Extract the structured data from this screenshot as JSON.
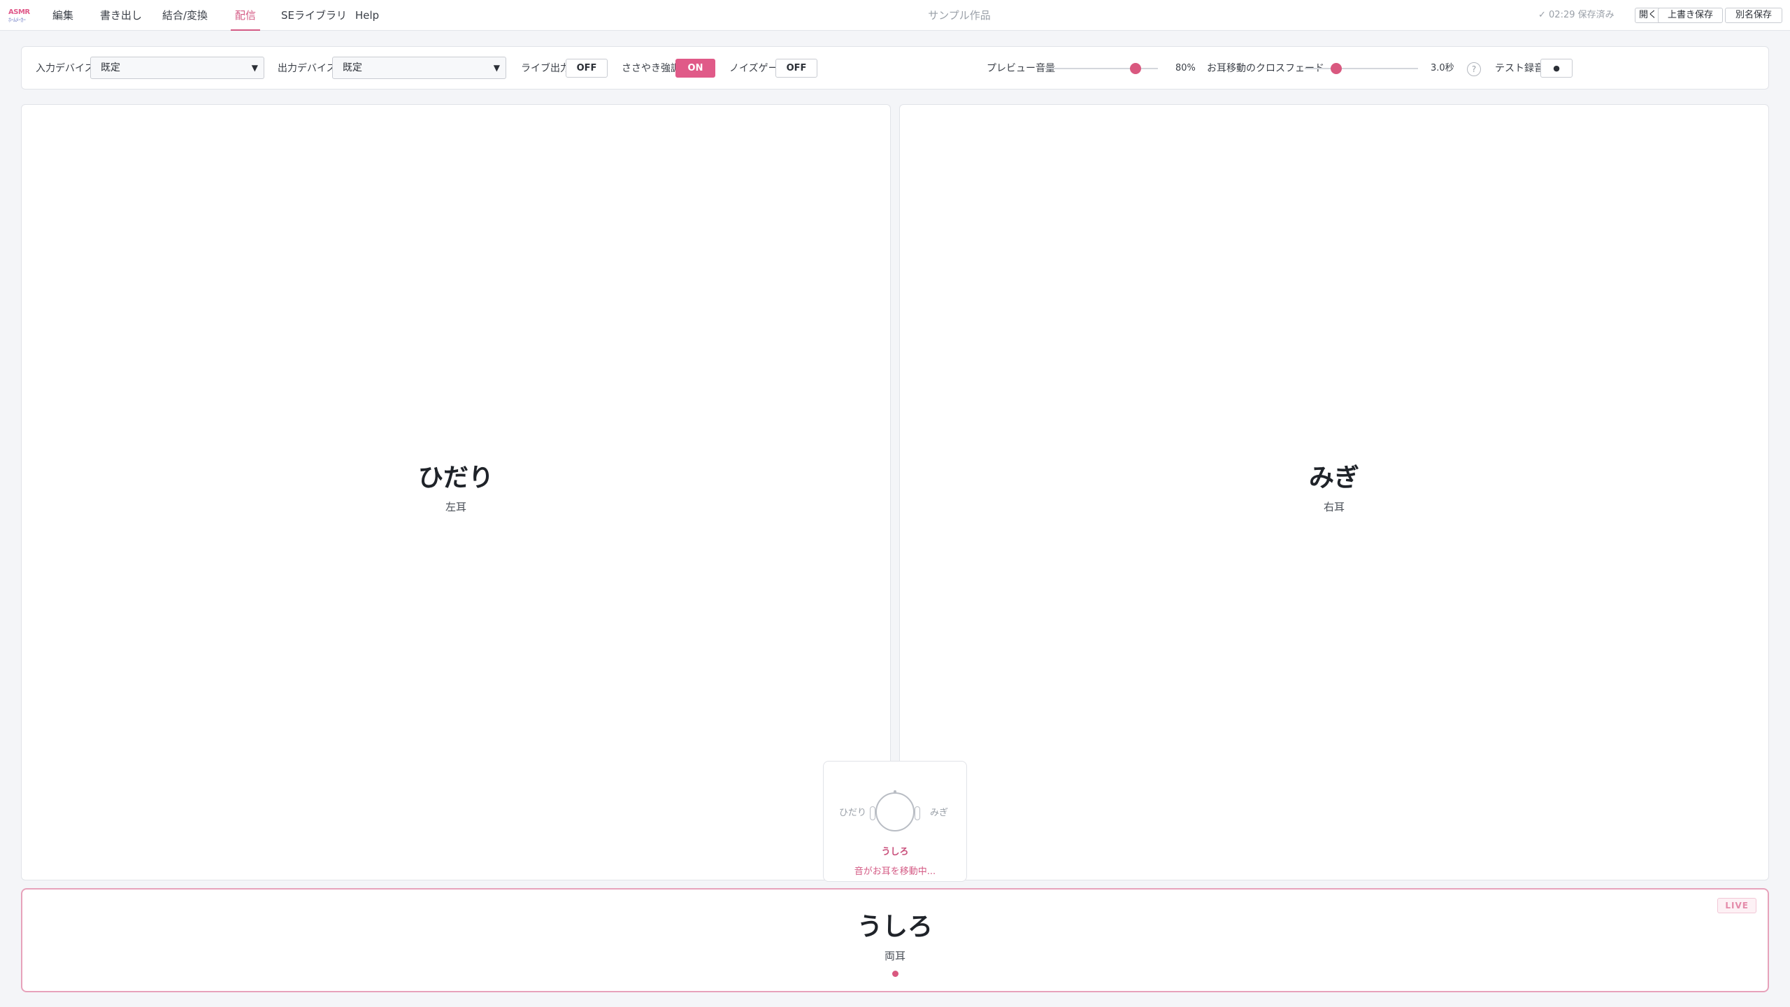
{
  "app": {
    "logo_line1": "ASMR",
    "logo_line2": "ﾎｰﾑﾒｰｶｰ",
    "project_title": "サンプル作品"
  },
  "nav": {
    "tabs": [
      {
        "label": "編集"
      },
      {
        "label": "書き出し"
      },
      {
        "label": "結合/変換"
      },
      {
        "label": "配信",
        "active": true
      },
      {
        "label": "SEライブラリ"
      },
      {
        "label": "Help"
      }
    ]
  },
  "header": {
    "save_status": "✓ 02:29 保存済み",
    "open_label": "開く",
    "overwrite_label": "上書き保存",
    "save_as_label": "別名保存"
  },
  "controls": {
    "input_device_label": "入力デバイス",
    "input_device_value": "既定",
    "output_device_label": "出力デバイス",
    "output_device_value": "既定",
    "live_output_label": "ライブ出力",
    "live_output_state": "OFF",
    "whisper_label": "ささやき強調",
    "whisper_state": "ON",
    "noise_gate_label": "ノイズゲート",
    "noise_gate_state": "OFF",
    "preview_volume_label": "プレビュー音量",
    "preview_volume_value": "80%",
    "preview_volume_fraction": 0.8,
    "crossfade_label": "お耳移動のクロスフェード",
    "crossfade_value": "3.0秒",
    "crossfade_fraction": 0.28,
    "help_icon": "?",
    "test_record_label": "テスト録音",
    "test_record_icon": "●"
  },
  "panels": {
    "left": {
      "title": "ひだり",
      "subtitle": "左耳"
    },
    "right": {
      "title": "みぎ",
      "subtitle": "右耳"
    },
    "back": {
      "title": "うしろ",
      "subtitle": "両耳",
      "badge": "LIVE"
    }
  },
  "indicator": {
    "left_label": "ひだり",
    "right_label": "みぎ",
    "position": "うしろ",
    "status": "音がお耳を移動中..."
  },
  "colors": {
    "accent": "#d9587f",
    "live_border": "#e7a2bb"
  }
}
